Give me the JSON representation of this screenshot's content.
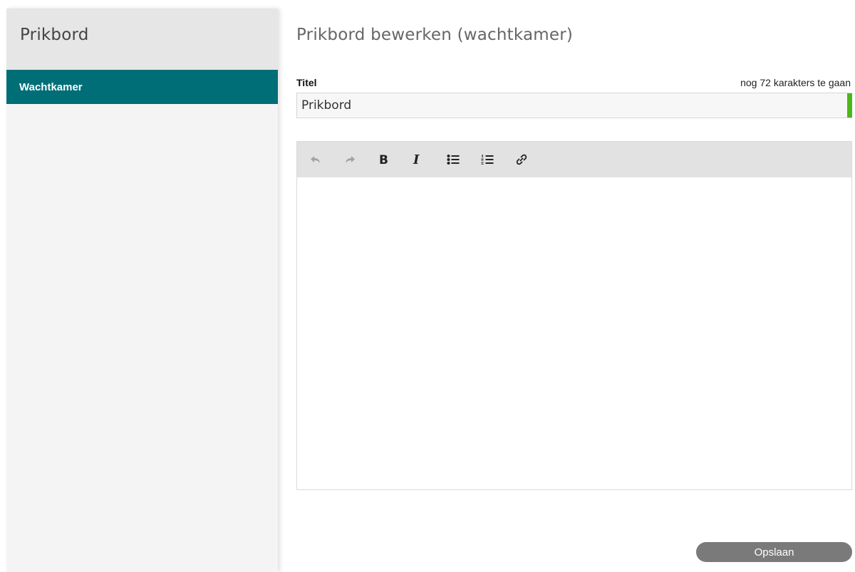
{
  "sidebar": {
    "title": "Prikbord",
    "items": [
      {
        "label": "Wachtkamer",
        "active": true
      }
    ]
  },
  "main": {
    "page_title": "Prikbord bewerken (wachtkamer)",
    "title_field": {
      "label": "Titel",
      "counter": "nog 72 karakters te gaan",
      "value": "Prikbord"
    },
    "editor": {
      "toolbar": [
        "undo-icon",
        "redo-icon",
        "bold-icon",
        "italic-icon",
        "bullet-list-icon",
        "numbered-list-icon",
        "link-icon"
      ],
      "content": ""
    },
    "save_label": "Opslaan"
  },
  "colors": {
    "sidebar_active": "#006e77",
    "valid_indicator": "#4cb71b",
    "save_button": "#7a7a7a"
  }
}
